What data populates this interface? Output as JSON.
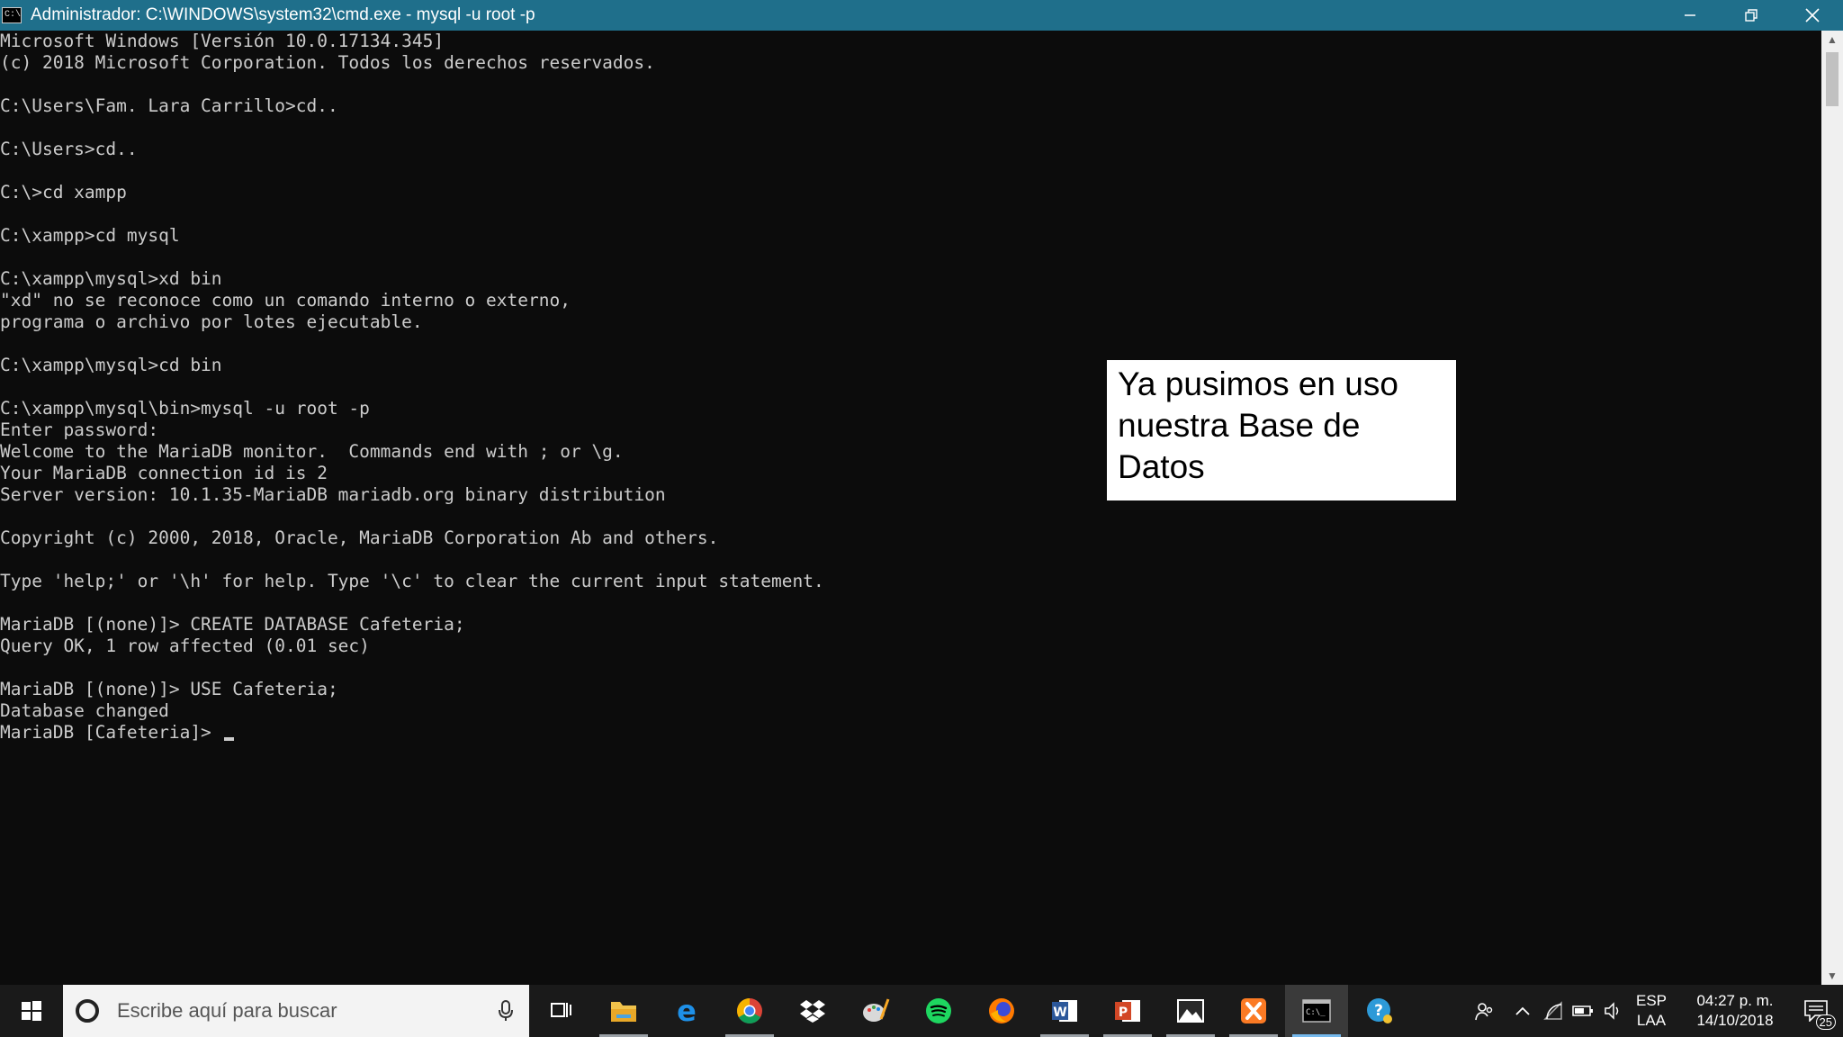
{
  "window": {
    "title": "Administrador: C:\\WINDOWS\\system32\\cmd.exe - mysql  -u root -p",
    "icon_text": "C:\\"
  },
  "console": {
    "lines": [
      "Microsoft Windows [Versión 10.0.17134.345]",
      "(c) 2018 Microsoft Corporation. Todos los derechos reservados.",
      "",
      "C:\\Users\\Fam. Lara Carrillo>cd..",
      "",
      "C:\\Users>cd..",
      "",
      "C:\\>cd xampp",
      "",
      "C:\\xampp>cd mysql",
      "",
      "C:\\xampp\\mysql>xd bin",
      "\"xd\" no se reconoce como un comando interno o externo,",
      "programa o archivo por lotes ejecutable.",
      "",
      "C:\\xampp\\mysql>cd bin",
      "",
      "C:\\xampp\\mysql\\bin>mysql -u root -p",
      "Enter password:",
      "Welcome to the MariaDB monitor.  Commands end with ; or \\g.",
      "Your MariaDB connection id is 2",
      "Server version: 10.1.35-MariaDB mariadb.org binary distribution",
      "",
      "Copyright (c) 2000, 2018, Oracle, MariaDB Corporation Ab and others.",
      "",
      "Type 'help;' or '\\h' for help. Type '\\c' to clear the current input statement.",
      "",
      "MariaDB [(none)]> CREATE DATABASE Cafeteria;",
      "Query OK, 1 row affected (0.01 sec)",
      "",
      "MariaDB [(none)]> USE Cafeteria;",
      "Database changed"
    ],
    "prompt": "MariaDB [Cafeteria]> "
  },
  "annotation": {
    "line1": "Ya pusimos en uso",
    "line2": "nuestra Base de",
    "line3": "Datos"
  },
  "taskbar": {
    "search_placeholder": "Escribe aquí para buscar",
    "apps": [
      {
        "name": "task-view-icon"
      },
      {
        "name": "file-explorer-icon"
      },
      {
        "name": "edge-icon"
      },
      {
        "name": "chrome-icon"
      },
      {
        "name": "dropbox-icon"
      },
      {
        "name": "paint-icon"
      },
      {
        "name": "spotify-icon"
      },
      {
        "name": "firefox-icon"
      },
      {
        "name": "word-icon"
      },
      {
        "name": "powerpoint-icon"
      },
      {
        "name": "photos-icon"
      },
      {
        "name": "xampp-icon"
      },
      {
        "name": "cmd-icon"
      }
    ],
    "tray": {
      "lang_top": "ESP",
      "lang_bottom": "LAA",
      "time": "04:27 p. m.",
      "date": "14/10/2018",
      "notifications": "25"
    }
  },
  "colors": {
    "titlebar": "#1f6f8b",
    "console_bg": "#0c0c0c",
    "console_text": "#cccccc",
    "taskbar": "#1a1a1a"
  }
}
